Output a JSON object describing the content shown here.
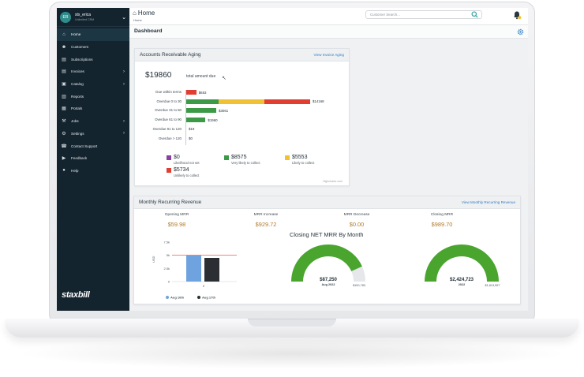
{
  "sidebar": {
    "user": {
      "initials": "ER",
      "name": "stx_erica",
      "subtitle": "Unlimited CRM"
    },
    "items": [
      {
        "label": "Home",
        "icon": "home-icon",
        "active": true,
        "chevron": ""
      },
      {
        "label": "Customers",
        "icon": "users-icon",
        "chevron": ""
      },
      {
        "label": "Subscriptions",
        "icon": "layers-icon",
        "chevron": ""
      },
      {
        "label": "Invoices",
        "icon": "invoice-icon",
        "chevron": "›"
      },
      {
        "label": "Catalog",
        "icon": "catalog-icon",
        "chevron": "›"
      },
      {
        "label": "Reports",
        "icon": "report-icon",
        "chevron": ""
      },
      {
        "label": "Portals",
        "icon": "portal-icon",
        "chevron": ""
      },
      {
        "label": "Jobs",
        "icon": "wrench-icon",
        "chevron": "›"
      },
      {
        "label": "Settings",
        "icon": "gear-icon",
        "chevron": "›"
      },
      {
        "label": "Contact Support",
        "icon": "support-icon",
        "chevron": ""
      },
      {
        "label": "Feedback",
        "icon": "megaphone-icon",
        "chevron": ""
      },
      {
        "label": "Help",
        "icon": "help-icon",
        "chevron": ""
      }
    ],
    "brand": "staxbill"
  },
  "header": {
    "title": "Home",
    "breadcrumb": "Home",
    "search_placeholder": "Customer Search..."
  },
  "dashboard": {
    "title": "Dashboard"
  },
  "ar_aging": {
    "title": "Accounts Receivable Aging",
    "link": "View Invoice Aging",
    "total": "$19860",
    "total_label": "total amount due",
    "credit": "Highcharts.com",
    "rows": [
      {
        "label": "Due within terms",
        "value_label": "$653",
        "segments": [
          {
            "value": 653,
            "color": "#e23d31"
          }
        ]
      },
      {
        "label": "Overdue 0 to 30",
        "value_label": "$14168",
        "segments": [
          {
            "value": 2100,
            "color": "#3c9a46"
          },
          {
            "value": 3000,
            "color": "#f0c233"
          },
          {
            "value": 2950,
            "color": "#e23d31"
          }
        ]
      },
      {
        "label": "Overdue 31 to 60",
        "value_label": "$3061",
        "segments": [
          {
            "value": 1950,
            "color": "#3c9a46"
          }
        ]
      },
      {
        "label": "Overdue 61 to 90",
        "value_label": "$1960",
        "segments": [
          {
            "value": 1250,
            "color": "#3c9a46"
          }
        ]
      },
      {
        "label": "Overdue 91 to 120",
        "value_label": "$19",
        "segments": []
      },
      {
        "label": "Overdue > 120",
        "value_label": "$0",
        "segments": []
      }
    ],
    "legend": [
      {
        "value": "$0",
        "label": "Likelihood not set",
        "color": "#8b3fa0"
      },
      {
        "value": "$8575",
        "label": "Very likely to collect",
        "color": "#3c9a46"
      },
      {
        "value": "$5553",
        "label": "Likely to collect",
        "color": "#f0c233"
      },
      {
        "value": "$5734",
        "label": "Unlikely to collect",
        "color": "#e23d31"
      }
    ]
  },
  "mrr": {
    "title": "Monthly Recurring Revenue",
    "link": "View Monthly Recurring Revenue",
    "stats": [
      {
        "label": "Opening MRR",
        "value": "$59.98"
      },
      {
        "label": "MRR Increase",
        "value": "$929.72"
      },
      {
        "label": "MRR Decrease",
        "value": "$0.00"
      },
      {
        "label": "Closing MRR",
        "value": "$989.70"
      }
    ],
    "net_title": "Closing NET MRR By Month"
  },
  "chart_data": [
    {
      "type": "bar",
      "categories": [
        "0"
      ],
      "ylabel": "USD",
      "yticks": [
        "7.5k",
        "5k",
        "2.5k",
        "0"
      ],
      "ylim": [
        0,
        7500
      ],
      "reference_line": 5000,
      "series": [
        {
          "name": "Aug 16th",
          "values": [
            5000
          ],
          "color": "#6fa3e0"
        },
        {
          "name": "Aug 17th",
          "values": [
            4500
          ],
          "color": "#2b2f33"
        }
      ]
    },
    {
      "type": "pie",
      "value": 87250,
      "max": 100783,
      "center_value": "$87,250",
      "center_label": "Aug 2022",
      "max_label": "$100,783",
      "color": "#4aa52f"
    },
    {
      "type": "pie",
      "value": 2424723,
      "max": 1813557,
      "center_value": "$2,424,723",
      "center_label": "2022",
      "max_label": "$1,813,557",
      "color": "#4aa52f"
    }
  ]
}
